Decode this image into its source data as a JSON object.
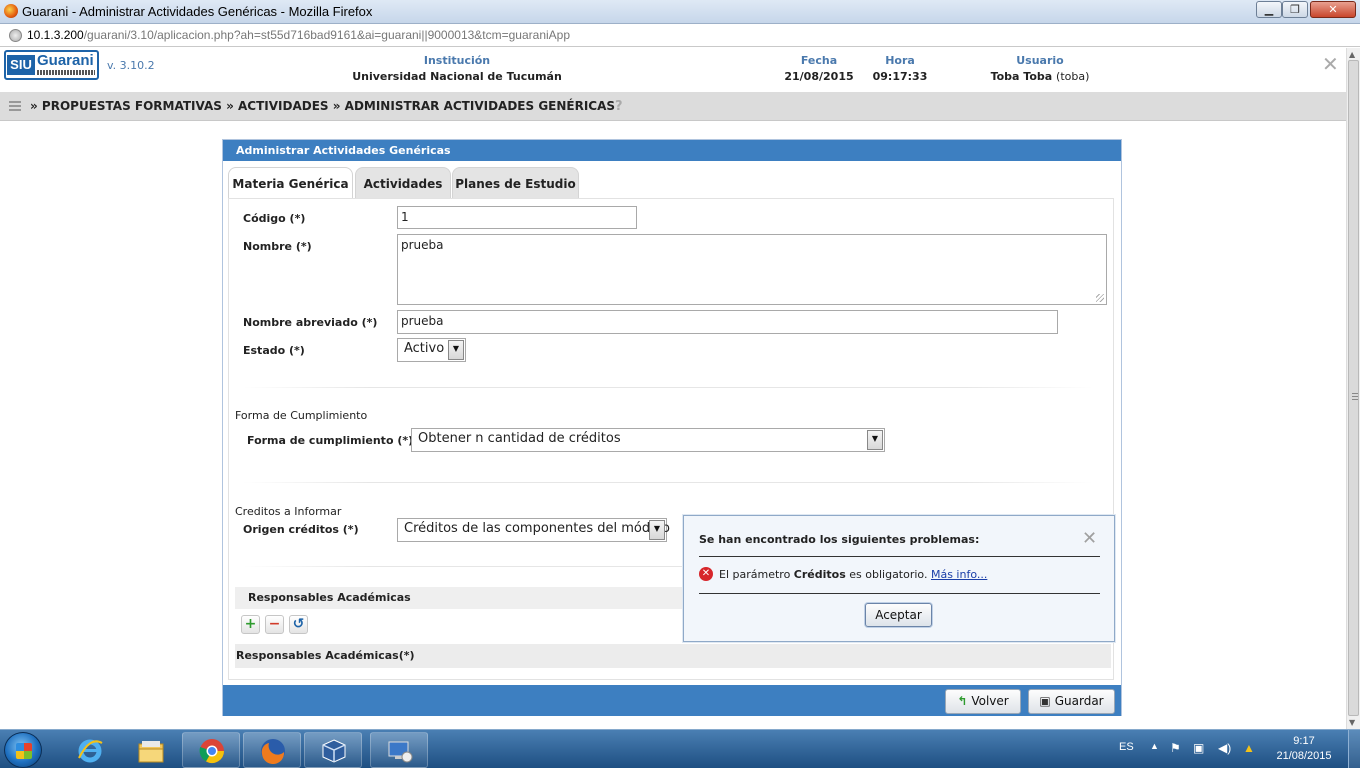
{
  "window": {
    "title": "Guarani - Administrar Actividades Genéricas - Mozilla Firefox",
    "minimize_label": "▁",
    "maximize_label": "❐",
    "close_label": "✕"
  },
  "browser": {
    "url_host": "10.1.3.200",
    "url_path": "/guarani/3.10/aplicacion.php?ah=st55d716bad9161&ai=guarani||9000013&tcm=guaraniApp"
  },
  "header": {
    "logo_siu": "SIU",
    "logo_name": "Guarani",
    "version": "v. 3.10.2",
    "institucion_label": "Institución",
    "institucion_value": "Universidad Nacional de Tucumán",
    "fecha_label": "Fecha",
    "fecha_value": "21/08/2015",
    "hora_label": "Hora",
    "hora_value": "09:17:33",
    "usuario_label": "Usuario",
    "usuario_value": "Toba Toba",
    "usuario_id": "(toba)"
  },
  "breadcrumb": {
    "text": "» PROPUESTAS FORMATIVAS » ACTIVIDADES » ADMINISTRAR ACTIVIDADES GENÉRICAS",
    "help": "?"
  },
  "panel": {
    "title": "Administrar Actividades Genéricas",
    "tabs": [
      {
        "label": "Materia Genérica"
      },
      {
        "label": "Actividades"
      },
      {
        "label": "Planes de Estudio"
      }
    ]
  },
  "form": {
    "codigo_label": "Código (*)",
    "codigo_value": "1",
    "nombre_label": "Nombre (*)",
    "nombre_value": "prueba",
    "nombre_abreviado_label": "Nombre abreviado (*)",
    "nombre_abreviado_value": "prueba",
    "estado_label": "Estado (*)",
    "estado_value": "Activo",
    "forma_section_title": "Forma de Cumplimiento",
    "forma_label": "Forma de cumplimiento (*)",
    "forma_value": "Obtener n cantidad de créditos",
    "creditos_section_title": "Creditos a Informar",
    "origen_label": "Origen créditos (*)",
    "origen_value": "Créditos de las componentes del módulo",
    "responsables_title": "Responsables Académicas",
    "responsables_list_header": "Responsables Académicas(*)"
  },
  "buttons": {
    "add": "+",
    "remove": "−",
    "undo": "↺",
    "volver": "Volver",
    "guardar": "Guardar"
  },
  "dialog": {
    "title": "Se han encontrado los siguientes problemas:",
    "message_prefix": "El parámetro",
    "message_param": "Créditos",
    "message_suffix": "es obligatorio.",
    "more_info": "Más info...",
    "accept": "Aceptar"
  },
  "taskbar": {
    "language": "ES",
    "time": "9:17",
    "date": "21/08/2015",
    "apps": [
      "internet-explorer-icon",
      "file-explorer-icon",
      "chrome-icon",
      "firefox-icon",
      "virtualbox-icon",
      "remote-desktop-icon"
    ]
  },
  "colors": {
    "panel_header": "#3d7fc1",
    "header_label": "#4a79ad",
    "error": "#d7262b"
  }
}
